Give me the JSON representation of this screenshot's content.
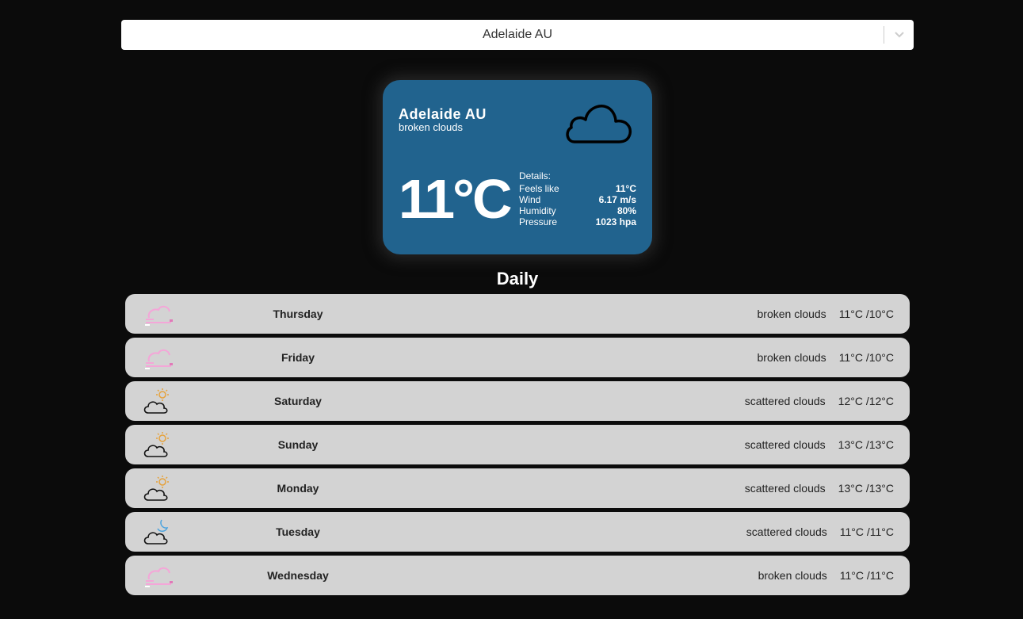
{
  "search": {
    "selected_value": "Adelaide AU",
    "chevron_icon": "chevron-down-icon"
  },
  "current": {
    "city": "Adelaide AU",
    "description": "broken clouds",
    "icon": "cloud-icon",
    "temperature": "11°C",
    "details_title": "Details:",
    "details": [
      {
        "label": "Feels like",
        "value": "11°C"
      },
      {
        "label": "Wind",
        "value": "6.17 m/s"
      },
      {
        "label": "Humidity",
        "value": "80%"
      },
      {
        "label": "Pressure",
        "value": "1023 hpa"
      }
    ],
    "card_color": "#21638e"
  },
  "daily": {
    "title": "Daily",
    "days": [
      {
        "day": "Thursday",
        "description": "broken clouds",
        "temps": "11°C /10°C",
        "icon": "broken-clouds-icon"
      },
      {
        "day": "Friday",
        "description": "broken clouds",
        "temps": "11°C /10°C",
        "icon": "broken-clouds-icon"
      },
      {
        "day": "Saturday",
        "description": "scattered clouds",
        "temps": "12°C /12°C",
        "icon": "partly-sunny-icon"
      },
      {
        "day": "Sunday",
        "description": "scattered clouds",
        "temps": "13°C /13°C",
        "icon": "partly-sunny-icon"
      },
      {
        "day": "Monday",
        "description": "scattered clouds",
        "temps": "13°C /13°C",
        "icon": "partly-sunny-icon"
      },
      {
        "day": "Tuesday",
        "description": "scattered clouds",
        "temps": "11°C /11°C",
        "icon": "cloudy-night-icon"
      },
      {
        "day": "Wednesday",
        "description": "broken clouds",
        "temps": "11°C /11°C",
        "icon": "broken-clouds-icon"
      }
    ]
  }
}
